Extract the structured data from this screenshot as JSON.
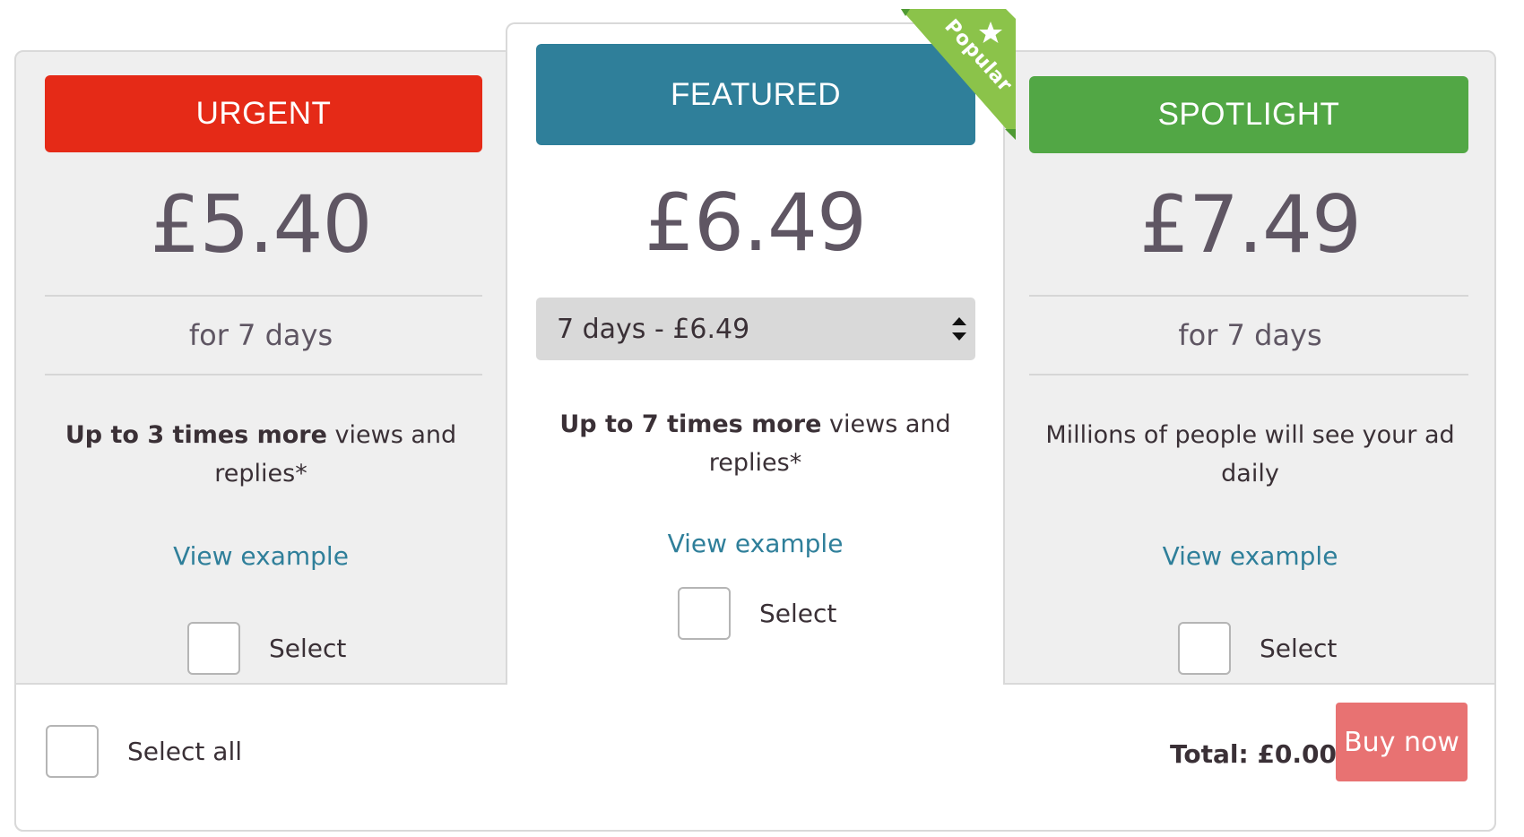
{
  "colors": {
    "urgent": "#e52a17",
    "featured": "#2f7f9a",
    "spotlight": "#52a745",
    "ribbon": "#8bc34a",
    "buy_button": "#e87272",
    "link": "#2f7f9a"
  },
  "cards": {
    "urgent": {
      "title": "URGENT",
      "price": "£5.40",
      "duration": "for 7 days",
      "desc_bold": "Up to 3 times more",
      "desc_rest": " views and replies*",
      "link": "View example",
      "select_label": "Select",
      "checked": false
    },
    "featured": {
      "title": "FEATURED",
      "price": "£6.49",
      "ribbon": "Popular",
      "ribbon_icon": "star-icon",
      "duration_select": {
        "selected": "7 days - £6.49"
      },
      "desc_bold": "Up to 7 times more",
      "desc_rest": " views and replies*",
      "link": "View example",
      "select_label": "Select",
      "checked": false
    },
    "spotlight": {
      "title": "SPOTLIGHT",
      "price": "£7.49",
      "duration": "for 7 days",
      "desc": "Millions of people will see your ad daily",
      "link": "View example",
      "select_label": "Select",
      "checked": false
    }
  },
  "footer": {
    "select_all_label": "Select all",
    "select_all_checked": false,
    "total": "Total: £0.00",
    "buy_label": "Buy now"
  }
}
